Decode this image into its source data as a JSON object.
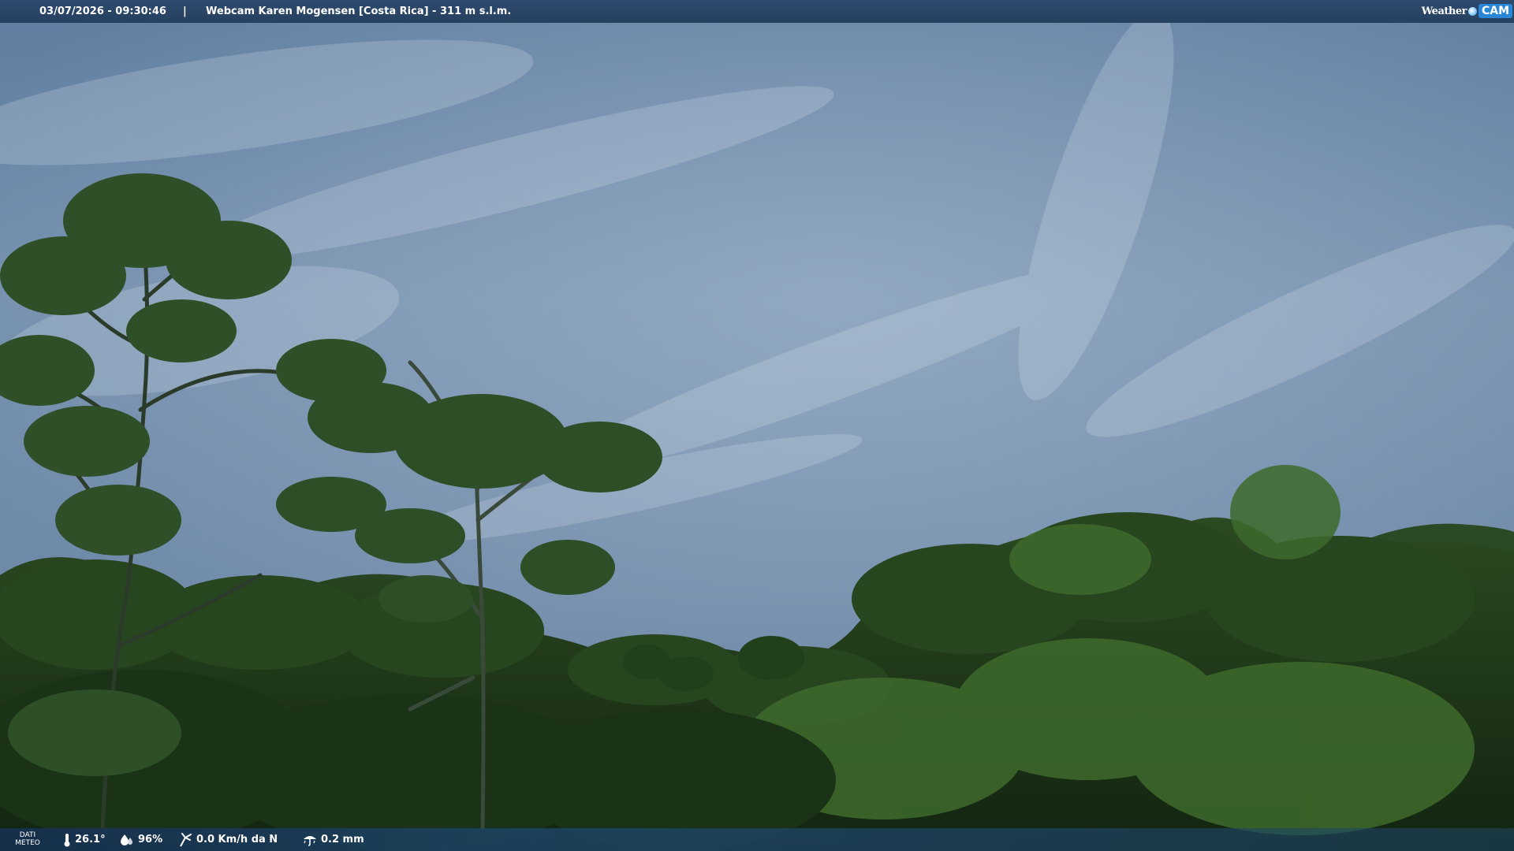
{
  "header": {
    "datetime": "03/07/2026 - 09:30:46",
    "separator": "|",
    "title": "Webcam Karen Mogensen [Costa Rica]  - 311 m s.l.m.",
    "logo": {
      "word": "Weather",
      "badge": "CAM"
    }
  },
  "footer": {
    "label_line1": "DATI",
    "label_line2": "METEO",
    "temperature": "26.1°",
    "humidity": "96%",
    "wind": "0.0 Km/h da N",
    "rain": "0.2 mm"
  },
  "icons": [
    "thermometer-icon",
    "humidity-drop-icon",
    "wind-icon",
    "rain-gauge-icon"
  ],
  "colors": {
    "bar": "#26405f",
    "logo_accent": "#2a87d8",
    "sky": "#6b88a8",
    "foliage": "#1f3a1a"
  }
}
